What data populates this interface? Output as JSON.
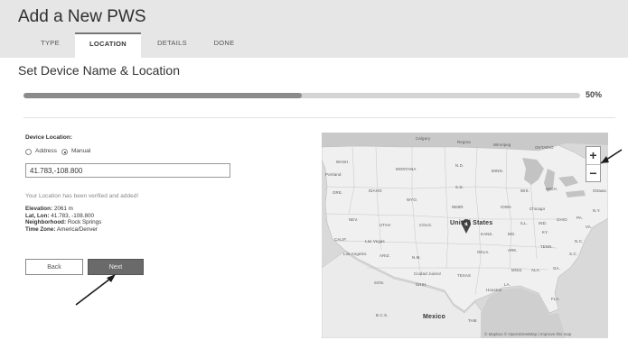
{
  "page": {
    "title": "Add a New PWS",
    "tabs": [
      {
        "label": "TYPE",
        "active": false
      },
      {
        "label": "LOCATION",
        "active": true
      },
      {
        "label": "DETAILS",
        "active": false
      },
      {
        "label": "DONE",
        "active": false
      }
    ],
    "section_heading": "Set Device Name & Location"
  },
  "progress": {
    "value": 0.5,
    "label": "50%"
  },
  "form": {
    "device_location_label": "Device Location:",
    "radio_address": "Address",
    "radio_manual": "Manual",
    "selected_mode": "Manual",
    "location_value": "41.783,-108.800",
    "verified_message": "Your Location has been verified and added!",
    "elevation_label": "Elevation:",
    "elevation_value": "2061 m",
    "latlon_label": "Lat, Lon:",
    "latlon_value": "41.783, -108.800",
    "neighborhood_label": "Neighborhood:",
    "neighborhood_value": "Rock Springs",
    "timezone_label": "Time Zone:",
    "timezone_value": "America/Denver",
    "back_label": "Back",
    "next_label": "Next"
  },
  "map": {
    "zoom_in": "+",
    "zoom_out": "−",
    "country_label": "United States",
    "attribution": "© Mapbox © OpenStreetMap | Improve this map",
    "labels": {
      "calgary": "Calgary",
      "regina": "Regina",
      "winnipeg": "Winnipeg",
      "ontario": "ONTARIO",
      "wash": "WASH.",
      "montana": "MONTANA",
      "nd": "N.D.",
      "minn": "MINN.",
      "portland": "Portland",
      "ore": "ORE.",
      "idaho": "IDAHO",
      "wyo": "WYO.",
      "sd": "S.D.",
      "wis": "WIS.",
      "mich": "MICH.",
      "ottawa": "Ottawa",
      "iowa": "IOWA",
      "nebr": "NEBR.",
      "chicago": "Chicago",
      "nev": "NEV.",
      "utah": "UTAH",
      "colo": "COLO.",
      "ill": "ILL.",
      "ind": "IND.",
      "ohio": "OHIO",
      "pa": "PA.",
      "ny": "N.Y.",
      "calif": "CALIF.",
      "las_vegas": "Las Vegas",
      "kans": "KANS.",
      "mo": "MO.",
      "ky": "KY.",
      "va": "VA.",
      "okla": "OKLA.",
      "ark": "ARK.",
      "tenn": "TENN.",
      "nc": "N.C.",
      "los_angeles": "Los Angeles",
      "ariz": "ARIZ.",
      "nm": "N.M.",
      "sc": "S.C.",
      "ciudad_juarez": "Ciudad Juárez",
      "texas": "TEXAS",
      "miss": "MISS.",
      "ala": "ALA.",
      "ga": "GA.",
      "son": "SON.",
      "chih": "CHIH.",
      "houston": "Houston",
      "la": "LA.",
      "fla": "FLA.",
      "bcs": "B.C.S.",
      "mexico": "Mexico",
      "tam": "TAM."
    }
  }
}
